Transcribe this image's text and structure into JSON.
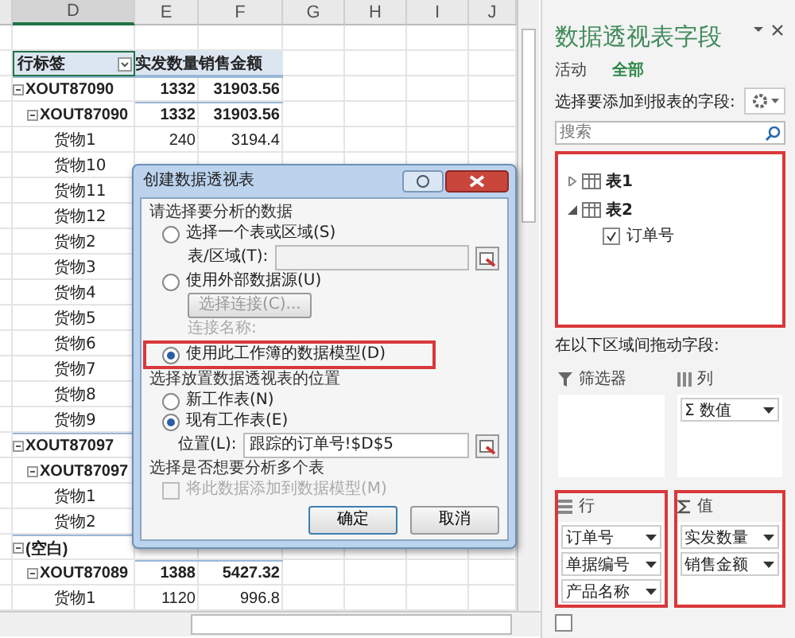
{
  "sheet": {
    "columns": [
      "D",
      "E",
      "F",
      "G",
      "H",
      "I",
      "J"
    ],
    "rows": [
      {
        "kind": "blank"
      },
      {
        "kind": "header",
        "label": "行标签",
        "qty": "实发数量",
        "amount": "销售金额"
      },
      {
        "kind": "group",
        "label": "XOUT87090",
        "qty": "1332",
        "amount": "31903.56",
        "expanded": true
      },
      {
        "kind": "subgroup",
        "label": "XOUT87090",
        "qty": "1332",
        "amount": "31903.56",
        "expanded": true
      },
      {
        "kind": "item",
        "label": "货物1",
        "qty": "240",
        "amount": "3194.4"
      },
      {
        "kind": "item",
        "label": "货物10"
      },
      {
        "kind": "item",
        "label": "货物11"
      },
      {
        "kind": "item",
        "label": "货物12"
      },
      {
        "kind": "item",
        "label": "货物2"
      },
      {
        "kind": "item",
        "label": "货物3"
      },
      {
        "kind": "item",
        "label": "货物4"
      },
      {
        "kind": "item",
        "label": "货物5"
      },
      {
        "kind": "item",
        "label": "货物6"
      },
      {
        "kind": "item",
        "label": "货物7"
      },
      {
        "kind": "item",
        "label": "货物8"
      },
      {
        "kind": "item",
        "label": "货物9"
      },
      {
        "kind": "group",
        "label": "XOUT87097",
        "expanded": true
      },
      {
        "kind": "subgroup",
        "label": "XOUT87097",
        "expanded": true
      },
      {
        "kind": "item",
        "label": "货物1"
      },
      {
        "kind": "item",
        "label": "货物2"
      },
      {
        "kind": "group",
        "label": "(空白)",
        "expanded": true
      },
      {
        "kind": "subgroup",
        "label": "XOUT87089",
        "qty": "1388",
        "amount": "5427.32",
        "expanded": true
      },
      {
        "kind": "item",
        "label": "货物1",
        "qty": "1120",
        "amount": "996.8"
      }
    ]
  },
  "dialog": {
    "title": "创建数据透视表",
    "section_1": {
      "title": "请选择要分析的数据",
      "option_1": {
        "label": "选择一个表或区域(S)",
        "selected": false
      },
      "range_label": "表/区域(T):",
      "option_2": {
        "label": "使用外部数据源(U)",
        "selected": false
      },
      "connect_button": "选择连接(C)...",
      "connection_label": "连接名称:",
      "option_3": {
        "label": "使用此工作簿的数据模型(D)",
        "selected": true,
        "highlighted": true
      }
    },
    "section_2": {
      "title": "选择放置数据透视表的位置",
      "options": [
        {
          "label": "新工作表(N)",
          "selected": false
        },
        {
          "label": "现有工作表(E)",
          "selected": true
        }
      ],
      "location_label": "位置(L):",
      "location_value": "跟踪的订单号!$D$5"
    },
    "section_3": {
      "title": "选择是否想要分析多个表",
      "checkbox": {
        "label": "将此数据添加到数据模型(M)",
        "checked": false,
        "disabled": true
      }
    },
    "buttons": [
      "确定",
      "取消"
    ]
  },
  "panel": {
    "title": "数据透视表字段",
    "tabs": [
      {
        "label": "活动",
        "selected": false
      },
      {
        "label": "全部",
        "selected": true
      }
    ],
    "prompt": "选择要添加到报表的字段:",
    "search": {
      "placeholder": "搜索"
    },
    "field_list": {
      "highlighted": true,
      "tables": [
        {
          "name": "表1",
          "expanded": false
        },
        {
          "name": "表2",
          "expanded": true,
          "fields": [
            {
              "label": "订单号",
              "checked": true
            }
          ]
        }
      ]
    },
    "drag_prompt": "在以下区域间拖动字段:",
    "areas": [
      {
        "kind": "filter",
        "title": "筛选器",
        "highlighted": false
      },
      {
        "kind": "columns",
        "title": "列",
        "highlighted": false,
        "items": [
          "Σ 数值"
        ]
      },
      {
        "kind": "rows",
        "title": "行",
        "highlighted": true,
        "items": [
          "订单号",
          "单据编号",
          "产品名称"
        ]
      },
      {
        "kind": "values",
        "title": "值",
        "highlighted": true,
        "items": [
          "实发数量",
          "销售金额"
        ]
      }
    ],
    "defer_update": {
      "checked": false
    }
  }
}
